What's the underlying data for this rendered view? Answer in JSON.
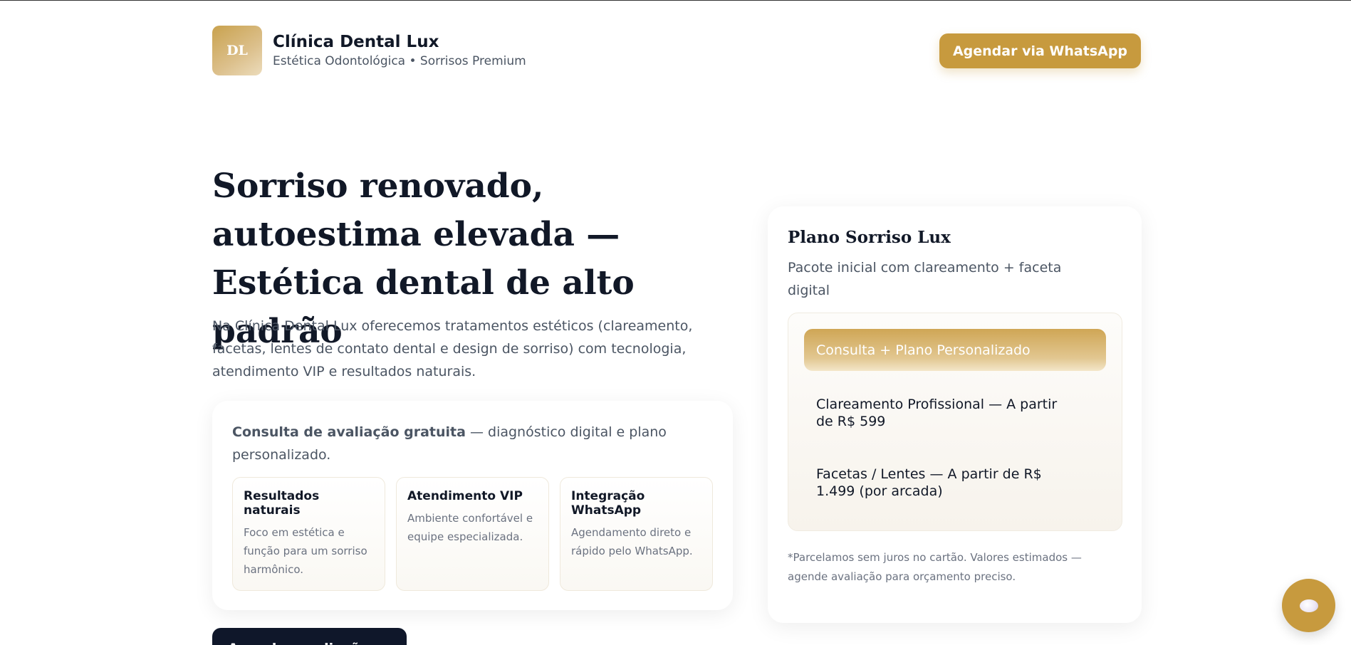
{
  "header": {
    "logo_text": "DL",
    "brand_name": "Clínica Dental Lux",
    "tagline": "Estética Odontológica • Sorrisos Premium",
    "cta_label": "Agendar via WhatsApp"
  },
  "hero": {
    "title": "Sorriso renovado, autoestima elevada — Estética dental de alto padrão",
    "description": "Na Clínica Dental Lux oferecemos tratamentos estéticos (clareamento, facetas, lentes de contato dental e design de sorriso) com tecnologia, atendimento VIP e resultados naturais."
  },
  "info": {
    "lead_strong": "Consulta de avaliação gratuita",
    "lead_rest": " — diagnóstico digital e plano personalizado.",
    "features": [
      {
        "title": "Resultados naturais",
        "text": "Foco em estética e função para um sorriso harmônico."
      },
      {
        "title": "Atendimento VIP",
        "text": "Ambiente confortável e equipe especializada."
      },
      {
        "title": "Integração WhatsApp",
        "text": "Agendamento direto e rápido pelo WhatsApp."
      }
    ]
  },
  "cta_secondary": "Agendar avaliação",
  "plan": {
    "title": "Plano Sorriso Lux",
    "subtitle": "Pacote inicial com clareamento + faceta digital",
    "options": [
      "Consulta + Plano Personalizado",
      "Clareamento Profissional — A partir de R$ 599",
      "Facetas / Lentes — A partir de R$ 1.499 (por arcada)"
    ],
    "note": "*Parcelamos sem juros no cartão. Valores estimados — agende avaliação para orçamento preciso."
  },
  "colors": {
    "accent": "#c79a3e",
    "dark": "#0f172a",
    "text": "#111827",
    "muted": "#4b5563"
  },
  "icons": {
    "chat_fab": "chat-bubble-icon"
  }
}
